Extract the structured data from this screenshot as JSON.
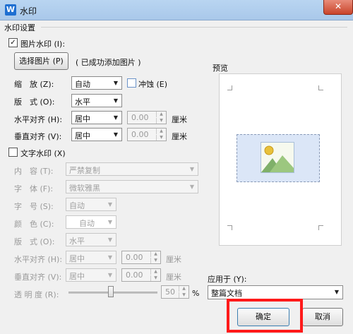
{
  "window": {
    "title": "水印",
    "app_icon": "W",
    "close_glyph": "✕"
  },
  "section_title": "水印设置",
  "picture_watermark": {
    "checkbox_label": "图片水印 (I):",
    "checked": true,
    "select_button": "选择图片 (P)",
    "status": "( 已成功添加图片 )",
    "scale_label": "缩　放 (Z):",
    "scale_value": "自动",
    "washout_label": "冲蚀 (E)",
    "washout_checked": false,
    "layout_label": "版　式 (O):",
    "layout_value": "水平",
    "halign_label": "水平对齐 (H):",
    "halign_value": "居中",
    "halign_offset": "0.00",
    "valign_label": "垂直对齐 (V):",
    "valign_value": "居中",
    "valign_offset": "0.00",
    "unit": "厘米"
  },
  "text_watermark": {
    "checkbox_label": "文字水印 (X)",
    "checked": false,
    "content_label": "内　容 (T):",
    "content_value": "严禁复制",
    "font_label": "字　体 (F):",
    "font_value": "微软雅黑",
    "size_label": "字　号 (S):",
    "size_value": "自动",
    "color_label": "颜　色 (C):",
    "color_value": "自动",
    "layout_label": "版　式 (O):",
    "layout_value": "水平",
    "halign_label": "水平对齐 (H):",
    "halign_value": "居中",
    "halign_offset": "0.00",
    "valign_label": "垂直对齐 (V):",
    "valign_value": "居中",
    "valign_offset": "0.00",
    "unit": "厘米",
    "transparency_label": "透 明 度 (R):",
    "transparency_value": "50",
    "transparency_unit": "%",
    "transparency_level": 0.5
  },
  "preview": {
    "label": "预览"
  },
  "apply_to": {
    "label": "应用于 (Y):",
    "value": "整篇文档"
  },
  "buttons": {
    "ok": "确定",
    "cancel": "取消"
  },
  "colors": {
    "title_bar": "#b9d5f1",
    "highlight": "#ff1a1a",
    "preview_bg": "#dbe6f7"
  }
}
